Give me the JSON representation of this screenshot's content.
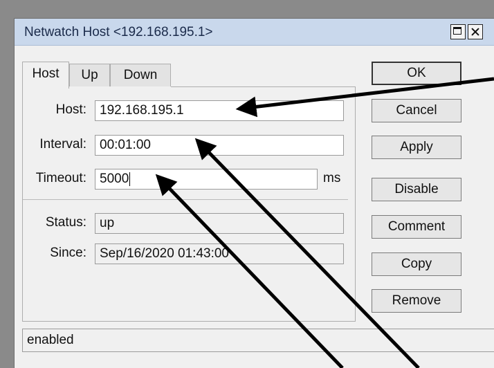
{
  "window": {
    "title": "Netwatch Host <192.168.195.1>"
  },
  "tabs": [
    {
      "label": "Host",
      "active": true
    },
    {
      "label": "Up",
      "active": false
    },
    {
      "label": "Down",
      "active": false
    }
  ],
  "form": {
    "host": {
      "label": "Host:",
      "value": "192.168.195.1"
    },
    "interval": {
      "label": "Interval:",
      "value": "00:01:00"
    },
    "timeout": {
      "label": "Timeout:",
      "value": "5000",
      "unit": "ms"
    },
    "status": {
      "label": "Status:",
      "value": "up"
    },
    "since": {
      "label": "Since:",
      "value": "Sep/16/2020 01:43:00"
    }
  },
  "buttons": {
    "ok": "OK",
    "cancel": "Cancel",
    "apply": "Apply",
    "disable": "Disable",
    "comment": "Comment",
    "copy": "Copy",
    "remove": "Remove"
  },
  "statusbar": {
    "text": "enabled"
  },
  "colors": {
    "titlebar": "#c9d8ec",
    "window_bg": "#f0f0f0",
    "backdrop": "#8a8a8a",
    "annotation_arrow": "#000000"
  },
  "icons": [
    "maximize-icon",
    "close-icon",
    "annotation-arrow"
  ]
}
